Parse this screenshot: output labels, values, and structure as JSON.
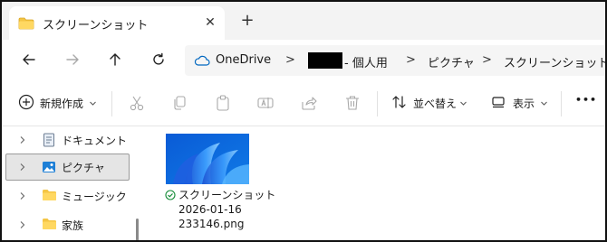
{
  "window": {
    "tab_title": "スクリーンショット",
    "tab_close": "✕",
    "new_tab": "+"
  },
  "address": {
    "onedrive": "OneDrive",
    "personal": "- 個人用",
    "pictures": "ピクチャ",
    "screenshots": "スクリーンショット",
    "separator": ">"
  },
  "toolbar": {
    "new_label": "新規作成",
    "sort_label": "並べ替え",
    "view_label": "表示",
    "more_label": "•••"
  },
  "sidebar": {
    "items": [
      {
        "label": "ドキュメント"
      },
      {
        "label": "ピクチャ"
      },
      {
        "label": "ミュージック"
      },
      {
        "label": "家族"
      }
    ]
  },
  "files": [
    {
      "line1": "スクリーンショット",
      "line2": "2026-01-16",
      "line3": "233146.png"
    }
  ],
  "colors": {
    "accent": "#0067c0",
    "folder": "#f4c544",
    "sync_ok": "#138a36"
  }
}
